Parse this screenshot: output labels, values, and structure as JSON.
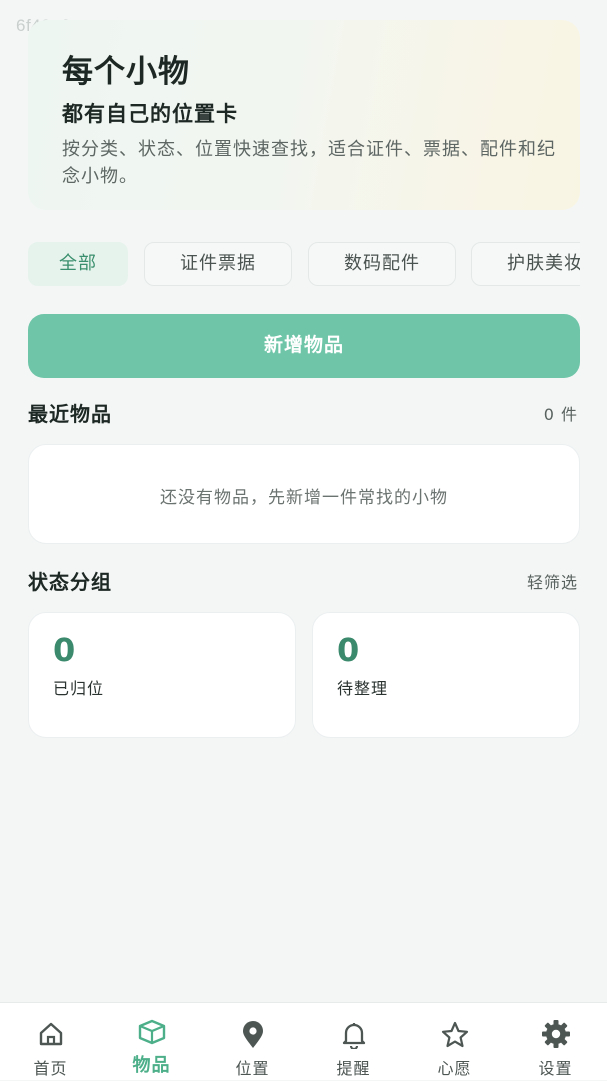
{
  "watermark": "6f40e2",
  "hero": {
    "title": "每个小物",
    "subtitle": "都有自己的位置卡",
    "description": "按分类、状态、位置快速查找，适合证件、票据、配件和纪念小物。"
  },
  "filters": [
    {
      "label": "全部",
      "active": true
    },
    {
      "label": "证件票据",
      "active": false
    },
    {
      "label": "数码配件",
      "active": false
    },
    {
      "label": "护肤美妆",
      "active": false
    }
  ],
  "add_button_label": "新增物品",
  "recent": {
    "title": "最近物品",
    "count_label": "0 件",
    "empty_text": "还没有物品，先新增一件常找的小物"
  },
  "status": {
    "title": "状态分组",
    "action_label": "轻筛选",
    "groups": [
      {
        "value": "0",
        "label": "已归位"
      },
      {
        "value": "0",
        "label": "待整理"
      }
    ]
  },
  "tabbar": {
    "active_color": "#4caf8a",
    "items": [
      {
        "label": "首页",
        "icon": "home-icon"
      },
      {
        "label": "物品",
        "icon": "box-icon",
        "active": true
      },
      {
        "label": "位置",
        "icon": "location-pin-icon"
      },
      {
        "label": "提醒",
        "icon": "bell-icon"
      },
      {
        "label": "心愿",
        "icon": "star-icon"
      },
      {
        "label": "设置",
        "icon": "gear-icon"
      }
    ]
  }
}
